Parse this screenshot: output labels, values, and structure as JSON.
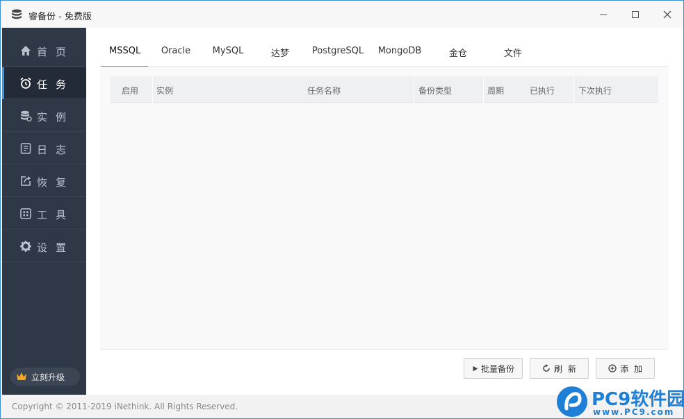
{
  "window": {
    "title": "睿备份 - 免费版",
    "controls": [
      "minimize-icon",
      "maximize-icon",
      "close-icon"
    ]
  },
  "sidebar": {
    "items": [
      {
        "label": "首页",
        "icon": "home-icon",
        "active": false
      },
      {
        "label": "任务",
        "icon": "alarm-clock-icon",
        "active": true
      },
      {
        "label": "实例",
        "icon": "database-icon",
        "active": false
      },
      {
        "label": "日志",
        "icon": "log-icon",
        "active": false
      },
      {
        "label": "恢复",
        "icon": "restore-icon",
        "active": false
      },
      {
        "label": "工具",
        "icon": "tools-icon",
        "active": false
      },
      {
        "label": "设置",
        "icon": "gear-icon",
        "active": false
      }
    ],
    "upgrade_label": "立刻升级"
  },
  "tabs": [
    {
      "label": "MSSQL",
      "active": true
    },
    {
      "label": "Oracle",
      "active": false
    },
    {
      "label": "MySQL",
      "active": false
    },
    {
      "label": "达梦",
      "active": false
    },
    {
      "label": "PostgreSQL",
      "active": false
    },
    {
      "label": "MongoDB",
      "active": false
    },
    {
      "label": "金仓",
      "active": false
    },
    {
      "label": "文件",
      "active": false
    }
  ],
  "table": {
    "columns": [
      "启用",
      "实例",
      "任务名称",
      "备份类型",
      "周期",
      "已执行",
      "下次执行"
    ],
    "rows": []
  },
  "buttons": {
    "batch_backup": "批量备份",
    "refresh": "刷新",
    "add": "添加"
  },
  "statusbar": {
    "copyright": "Copyright © 2011-2019 iNethink. All Rights Reserved."
  },
  "watermark": {
    "text": "PC9软件园",
    "url": "www.PC9.com"
  },
  "colors": {
    "accent": "#2e9bf0",
    "sidebar_bg": "#2e3847",
    "sidebar_active_bg": "#222b37",
    "upgrade_crown": "#f5a623"
  }
}
